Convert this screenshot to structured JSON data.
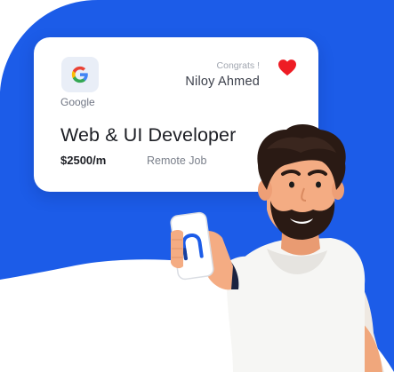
{
  "card": {
    "company": "Google",
    "congrats": "Congrats !",
    "person_name": "Niloy Ahmed",
    "job_title": "Web & UI Developer",
    "salary": "$2500/m",
    "job_type": "Remote Job"
  },
  "icons": {
    "logo": "google-logo-icon",
    "favorite": "heart-icon",
    "phone_logo": "n-logo-icon"
  },
  "colors": {
    "background_blue": "#1c5ce8",
    "heart": "#ee1c24",
    "card": "#ffffff"
  }
}
